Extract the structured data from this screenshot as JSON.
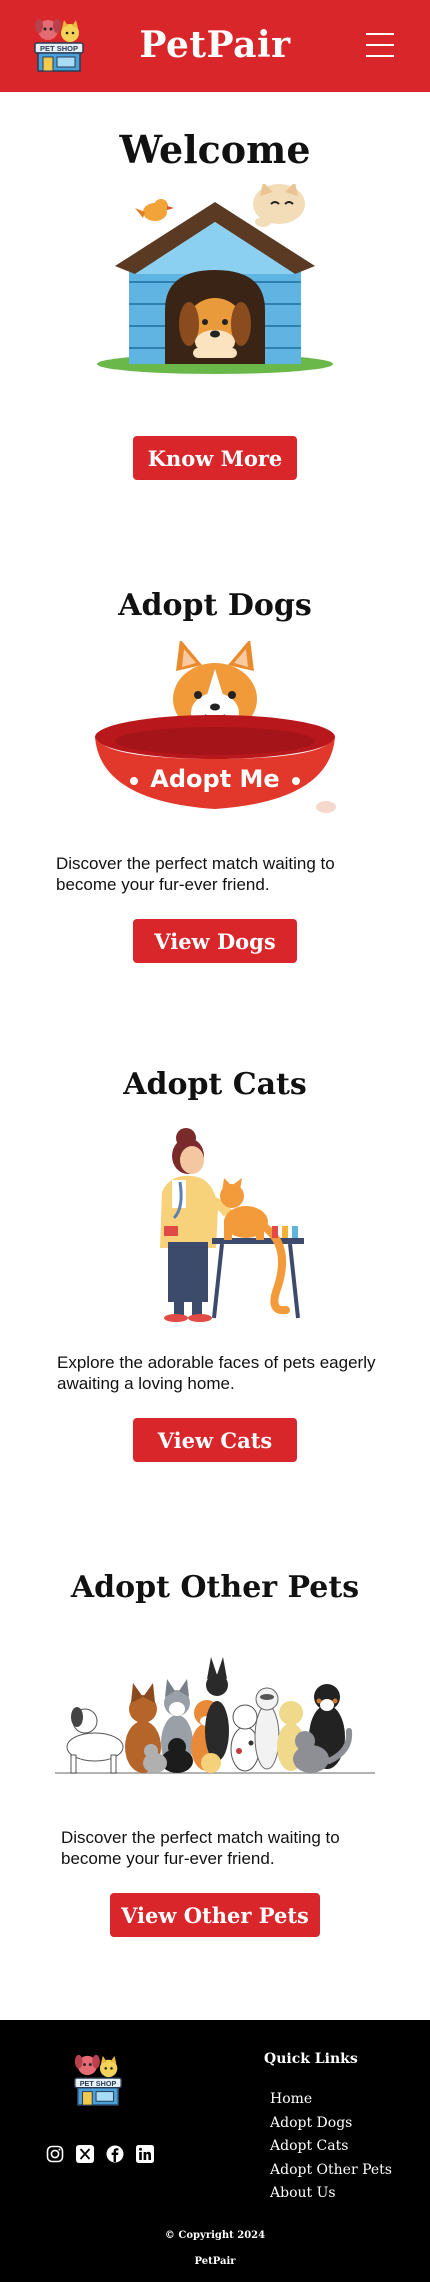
{
  "header": {
    "logo_text": "PET SHOP",
    "brand": "PetPair",
    "menu_icon": "hamburger-menu-icon"
  },
  "hero": {
    "title": "Welcome",
    "button": "Know More"
  },
  "dogs": {
    "title": "Adopt Dogs",
    "bowl_text": "Adopt Me",
    "description": "Discover the perfect match waiting to become your fur-ever friend.",
    "button": "View Dogs"
  },
  "cats": {
    "title": "Adopt Cats",
    "description": "Explore the adorable faces of pets eagerly awaiting a loving home.",
    "button": "View Cats"
  },
  "others": {
    "title": "Adopt Other Pets",
    "description": "Discover the perfect match waiting to become your fur-ever friend.",
    "button": "View Other Pets"
  },
  "footer": {
    "logo_text": "PET SHOP",
    "quick_links_title": "Quick Links",
    "links": [
      "Home",
      "Adopt Dogs",
      "Adopt Cats",
      "Adopt Other Pets",
      "About Us"
    ],
    "copyright": "© Copyright 2024",
    "brand": "PetPair",
    "social_icons": [
      "instagram-icon",
      "x-icon",
      "facebook-icon",
      "linkedin-icon"
    ]
  },
  "colors": {
    "brand_red": "#d9262a",
    "footer_bg": "#000000"
  }
}
